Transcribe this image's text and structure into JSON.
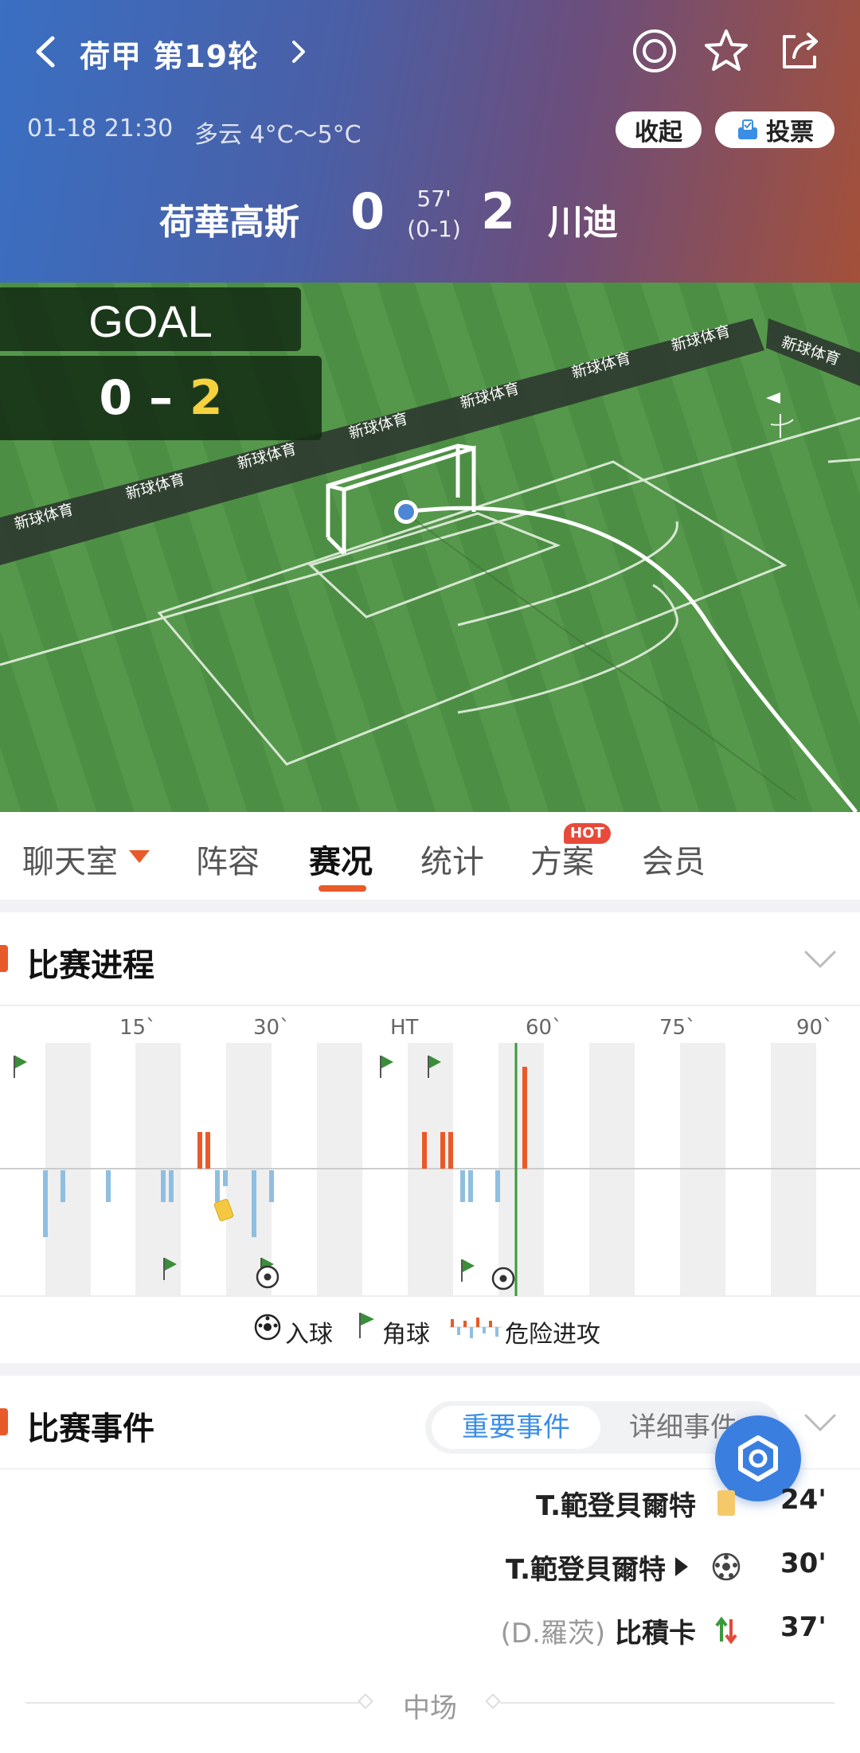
{
  "header": {
    "league_round": "荷甲 第19轮",
    "datetime": "01-18 21:30",
    "weather": "多云 4°C～5°C",
    "collapse_label": "收起",
    "vote_label": "投票",
    "home_team": "荷華高斯",
    "away_team": "川迪",
    "home_score": "0",
    "away_score": "2",
    "minute": "57'",
    "half_time_score": "(0-1)",
    "icons": [
      "back-icon",
      "chevron-right-icon",
      "target-icon",
      "star-icon",
      "share-icon",
      "vote-icon"
    ]
  },
  "pitch": {
    "goal_label": "GOAL",
    "score_home": "0",
    "score_dash": "–",
    "score_away": "2",
    "sponsor": "新球体育",
    "colors": {
      "grass": "#4a8c42",
      "highlight_score": "#f5d23e"
    }
  },
  "tabs": {
    "items": [
      "聊天室",
      "阵容",
      "赛况",
      "统计",
      "方案",
      "会员"
    ],
    "active": "赛况",
    "hot_badge": "HOT",
    "accent": "#e85a2a"
  },
  "progress": {
    "title": "比赛进程",
    "axis_ticks": [
      "15`",
      "30`",
      "HT",
      "60`",
      "75`",
      "90`"
    ],
    "current_minute": 57,
    "legend": {
      "goal": "入球",
      "corner": "角球",
      "danger": "危险进攻"
    },
    "colors": {
      "home_attack": "#e85a2a",
      "away_attack": "#8fbfe0",
      "corner_flag": "#3a8e3a",
      "current_line": "#3a9a3a"
    }
  },
  "events": {
    "title": "比赛事件",
    "seg_active": "重要事件",
    "seg_other": "详细事件",
    "rows": [
      {
        "player": "T.範登貝爾特",
        "sub": "",
        "icon": "yellow-card-icon",
        "minute": "24'"
      },
      {
        "player": "T.範登貝爾特",
        "sub": "",
        "icon": "goal-ball-icon",
        "minute": "30'",
        "play_marker": true
      },
      {
        "player": "比積卡",
        "sub": "(D.羅茨)",
        "icon": "substitution-icon",
        "minute": "37'"
      }
    ],
    "halftime_label": "中场"
  }
}
